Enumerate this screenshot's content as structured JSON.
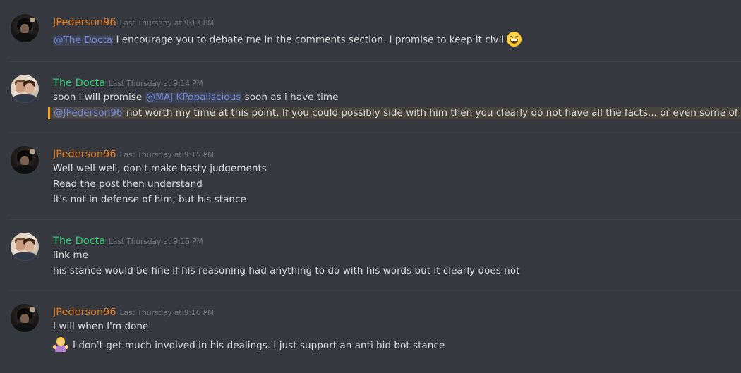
{
  "colors": {
    "background": "#36393f",
    "jpederson_name": "#e67e22",
    "docta_name": "#2ecc71",
    "mention": "#7289da",
    "timestamp": "#72767d",
    "text": "#dcddde",
    "highlight_bar": "#faa61a"
  },
  "messages": [
    {
      "author": "JPederson96",
      "timestamp": "Last Thursday at 9:13 PM",
      "avatar": "jpederson-avatar",
      "lines": [
        {
          "mention": "@The Docta",
          "text": " I encourage you to debate me in the comments section. I promise to keep it civil",
          "emoji": "laughing-face-emoji"
        }
      ]
    },
    {
      "author": "The Docta",
      "timestamp": "Last Thursday at 9:14 PM",
      "avatar": "docta-avatar",
      "lines": [
        {
          "text_before": "soon i will promise ",
          "mention": "@MAJ KPopaliscious",
          "text_after": " soon as i have time"
        },
        {
          "mention": "@JPederson96",
          "text": " not worth my time at this point. If you could possibly side with him then you clearly do not have all the facts... or even some of them",
          "highlighted": true
        }
      ]
    },
    {
      "author": "JPederson96",
      "timestamp": "Last Thursday at 9:15 PM",
      "avatar": "jpederson-avatar",
      "lines": [
        {
          "text": "Well well well, don't make hasty judgements"
        },
        {
          "text": "Read the post then understand"
        },
        {
          "text": "It's not in defense of him, but his stance"
        }
      ]
    },
    {
      "author": "The Docta",
      "timestamp": "Last Thursday at 9:15 PM",
      "avatar": "docta-avatar",
      "lines": [
        {
          "text": "link me"
        },
        {
          "text": "his stance would be fine if his reasoning had anything to do with his words but it clearly does not"
        }
      ]
    },
    {
      "author": "JPederson96",
      "timestamp": "Last Thursday at 9:16 PM",
      "avatar": "jpederson-avatar",
      "lines": [
        {
          "text": "I will when I'm done"
        },
        {
          "text": "I don't get much involved in his dealings. I just support an anti bid bot stance",
          "emoji": "person-shrugging-emoji"
        }
      ]
    }
  ]
}
